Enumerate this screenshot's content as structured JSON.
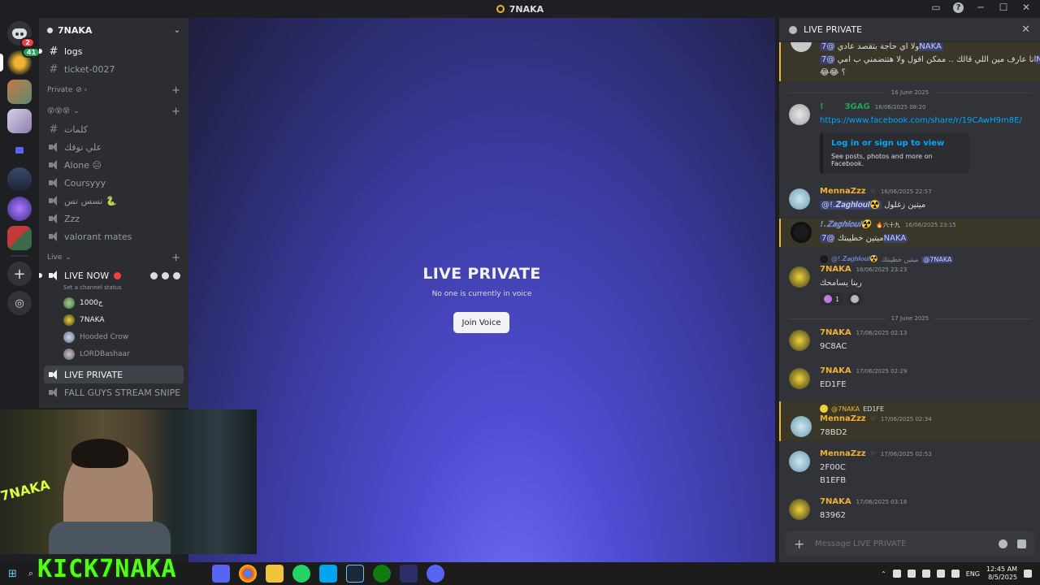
{
  "window": {
    "title": "7NAKA"
  },
  "guilds": {
    "home_badge": "2",
    "first_badge": "41"
  },
  "sidebar": {
    "server_name": "7NAKA",
    "top_channels": [
      {
        "name": "logs"
      },
      {
        "name": "ticket-0027"
      }
    ],
    "category_private": "Private",
    "category_emoji": "😵😵😵",
    "emoji_channels": [
      {
        "name": "كلمات"
      },
      {
        "name": "علي توقك"
      },
      {
        "name": "Alone 😐"
      },
      {
        "name": "Coursyyy"
      },
      {
        "name": "تسس تس 🐍"
      },
      {
        "name": "Zzz"
      },
      {
        "name": "valorant mates"
      }
    ],
    "category_live": "Live",
    "live_now": "LIVE NOW",
    "set_status": "Set a channel status",
    "voice_users": [
      {
        "name": "1000ج"
      },
      {
        "name": "7NAKA"
      },
      {
        "name": "Hooded Crow"
      },
      {
        "name": "LORDBashaar"
      }
    ],
    "live_private": "LIVE PRIVATE",
    "fall_guys": "FALL GUYS STREAM SNIPE"
  },
  "stage": {
    "title": "LIVE PRIVATE",
    "subtitle": "No one is currently in voice",
    "join_label": "Join Voice"
  },
  "chat": {
    "title": "LIVE PRIVATE",
    "top_msg_line1": "ولا اي حاجة بتقصد عادي",
    "top_msg_mention1": "@7NAKA",
    "top_msg_line2": "انا عارف مين اللي قالك .. ممكن اقول ولا هتتضمني ب امي",
    "top_msg_mention2": "@7NAKA",
    "top_msg_line3": "😂😂 ؟",
    "date1": "16 June 2025",
    "m1": {
      "author": "3GAG",
      "prefix": "!",
      "time": "16/06/2025 08:20",
      "link": "https://www.facebook.com/share/r/19CAwH9m8E/",
      "embed_title": "Log in or sign up to view",
      "embed_desc": "See posts, photos and more on Facebook."
    },
    "m2": {
      "author": "MennaZzz",
      "time": "16/06/2025 22:57",
      "mention": "@!.𝒁𝒂𝒈𝒉𝒍𝒐𝒖𝒍☢️",
      "text": "ميتين زغلول"
    },
    "m3": {
      "author": "!.𝒁𝒂𝒈𝒉𝒍𝒐𝒖𝒍☢️",
      "tag": "🔥六十九",
      "time": "16/06/2025 23:15",
      "text": "ميتين خطيبتك",
      "mention": "@7NAKA"
    },
    "m4": {
      "reply_author": "@!.𝒁𝒂𝒈𝒉𝒍𝒐𝒖𝒍☢️",
      "reply_text": "ميتين خطيبتك",
      "reply_mention": "@7NAKA",
      "author": "7NAKA",
      "time": "16/06/2025 23:23",
      "text": "ربنا يسامحك",
      "reaction_count": "1"
    },
    "date2": "17 June 2025",
    "m5": {
      "author": "7NAKA",
      "time": "17/06/2025 02:13",
      "text": "9C8AC"
    },
    "m6": {
      "author": "7NAKA",
      "time": "17/06/2025 02:29",
      "text": "ED1FE"
    },
    "m7": {
      "reply_author": "@7NAKA",
      "reply_text": "ED1FE",
      "author": "MennaZzz",
      "time": "17/06/2025 02:34",
      "text": "78BD2"
    },
    "m8": {
      "author": "MennaZzz",
      "time": "17/06/2025 02:53",
      "text": "2F00C",
      "text2": "B1EFB"
    },
    "m9": {
      "author": "7NAKA",
      "time": "17/06/2025 03:18",
      "text": "83962"
    },
    "composer_placeholder": "Message LIVE PRIVATE"
  },
  "overlay": {
    "kick_banner": "KICK7NAKA",
    "neon_sign": "7NAKA"
  },
  "taskbar": {
    "time": "12:45 AM",
    "date": "8/5/2025",
    "lang": "ENG"
  },
  "colors": {
    "accent": "#5865f2",
    "live_red": "#f23f43",
    "kick_green": "#53fc18",
    "author_gold": "#f0b232"
  }
}
